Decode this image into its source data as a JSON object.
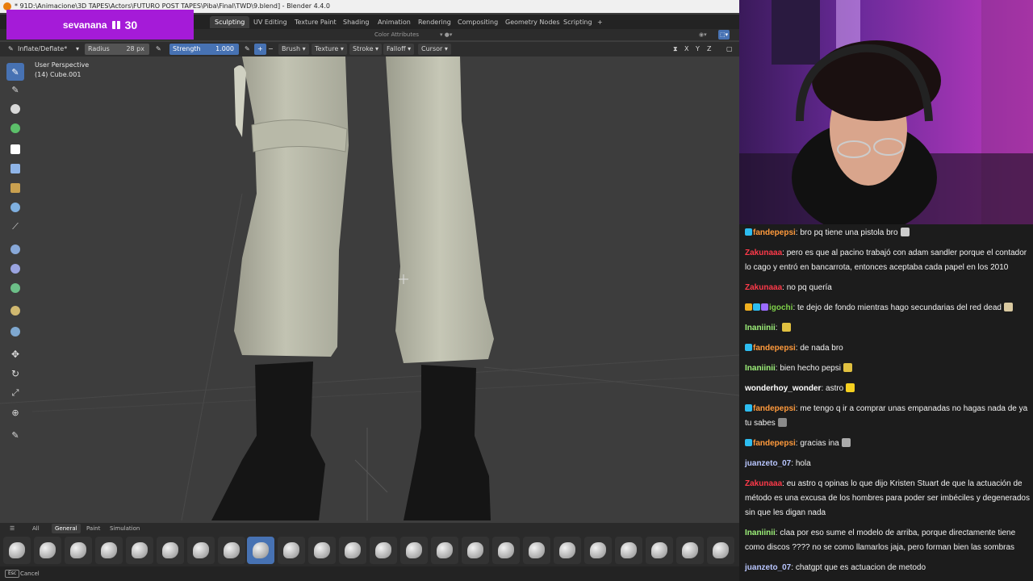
{
  "blender": {
    "window_title": "* 91D:\\Animacione\\3D TAPES\\Actors\\FUTURO POST TAPES\\Piba\\Final\\TWD\\9.blend] - Blender 4.4.0",
    "workspace_tabs": [
      "Sculpting",
      "UV Editing",
      "Texture Paint",
      "Shading",
      "Animation",
      "Rendering",
      "Compositing",
      "Geometry Nodes",
      "Scripting"
    ],
    "add_tab": "+",
    "viewport_header": {
      "color_attributes": "Color Attributes"
    },
    "tool_header": {
      "brush_name": "Inflate/Deflate*",
      "radius_label": "Radius",
      "radius_value": "28 px",
      "strength_label": "Strength",
      "strength_value": "1.000",
      "plus": "+",
      "minus": "−",
      "menus": [
        "Brush",
        "Texture",
        "Stroke",
        "Falloff",
        "Cursor"
      ],
      "axes": [
        "X",
        "Y",
        "Z"
      ]
    },
    "viewport": {
      "perspective": "User Perspective",
      "object": "(14) Cube.001"
    },
    "asset_tabs": [
      "All",
      "General",
      "Paint",
      "Simulation"
    ],
    "status": {
      "key": "Esc",
      "label": "Cancel"
    }
  },
  "sub_badge": {
    "name": "sevanana",
    "count": "30"
  },
  "chat": {
    "messages": [
      {
        "user": "fandepepsi",
        "color": "#ff9a3c",
        "text": "bro pq tiene una pistola bro",
        "badges": [
          "#2dbdf0"
        ],
        "emote": "#cccccc"
      },
      {
        "user": "Zakunaaa",
        "color": "#ff3a4a",
        "text": "pero es que al pacino trabajó con adam sandler porque el contador lo cago y entró en bancarrota, entonces aceptaba cada papel en los 2010",
        "badges": [],
        "emote": ""
      },
      {
        "user": "Zakunaaa",
        "color": "#ff3a4a",
        "text": "no pq quería",
        "badges": [],
        "emote": ""
      },
      {
        "user": "igochi",
        "color": "#7fd14a",
        "text": "te dejo de fondo mientras hago secundarias del red dead",
        "badges": [
          "#f0b020",
          "#2dbdf0",
          "#9a6bff"
        ],
        "emote": "#d9c9a0"
      },
      {
        "user": "Inaniinii",
        "color": "#9ef27a",
        "text": "",
        "badges": [],
        "emote": "#e0c040"
      },
      {
        "user": "fandepepsi",
        "color": "#ff9a3c",
        "text": "de nada bro",
        "badges": [
          "#2dbdf0"
        ],
        "emote": ""
      },
      {
        "user": "Inaniinii",
        "color": "#9ef27a",
        "text": "bien hecho pepsi",
        "badges": [],
        "emote": "#e0c040"
      },
      {
        "user": "wonderhoy_wonder",
        "color": "#ffffff",
        "text": "astro",
        "badges": [],
        "emote": "#f5d020"
      },
      {
        "user": "fandepepsi",
        "color": "#ff9a3c",
        "text": "me tengo q ir a comprar unas empanadas no hagas nada de ya tu sabes",
        "badges": [
          "#2dbdf0"
        ],
        "emote": "#8a8a8a"
      },
      {
        "user": "fandepepsi",
        "color": "#ff9a3c",
        "text": "gracias ina",
        "badges": [
          "#2dbdf0"
        ],
        "emote": "#aaaaaa"
      },
      {
        "user": "juanzeto_07",
        "color": "#b9c6ff",
        "text": "hola",
        "badges": [],
        "emote": ""
      },
      {
        "user": "Zakunaaa",
        "color": "#ff3a4a",
        "text": "eu astro q opinas lo que dijo Kristen Stuart de que la actuación de método es una excusa de los hombres para poder ser imbéciles y degenerados sin que les digan nada",
        "badges": [],
        "emote": ""
      },
      {
        "user": "Inaniinii",
        "color": "#9ef27a",
        "text": "claa por eso sume el modelo de arriba, porque directamente tiene como discos ???? no se como llamarlos jaja, pero forman bien las sombras",
        "badges": [],
        "emote": ""
      },
      {
        "user": "juanzeto_07",
        "color": "#b9c6ff",
        "text": "chatgpt que es actuacion de metodo",
        "badges": [],
        "emote": ""
      }
    ]
  }
}
